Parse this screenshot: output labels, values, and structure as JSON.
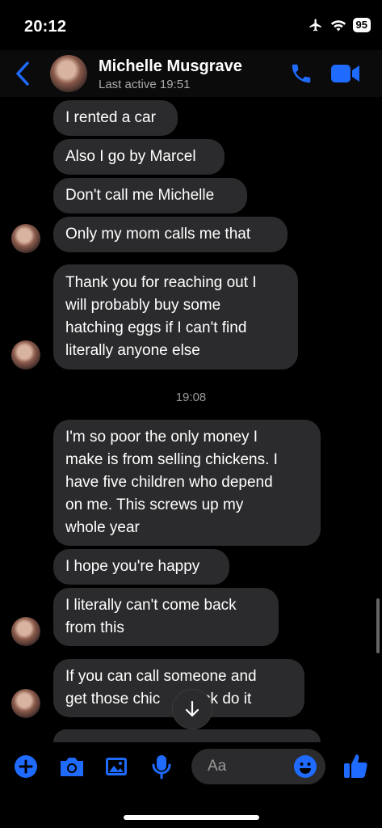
{
  "status": {
    "time": "20:12",
    "battery": "95"
  },
  "header": {
    "name": "Michelle Musgrave",
    "last_active": "Last active 19:51"
  },
  "messages": [
    {
      "text": "I rented a car"
    },
    {
      "text": "Also I go by Marcel"
    },
    {
      "text": "Don't call me Michelle"
    },
    {
      "text": "Only my mom calls me that"
    },
    {
      "lines": [
        "Thank you for reaching out I",
        "will probably buy some",
        "hatching eggs if I can't find",
        "literally anyone else"
      ]
    },
    {
      "lines": [
        "I'm so poor the only money I",
        "make is from selling chickens. I",
        "have five children who depend",
        "on me. This screws up my",
        "whole year"
      ]
    },
    {
      "text": "I hope you're happy"
    },
    {
      "lines": [
        "I literally can't come back",
        "from this"
      ]
    },
    {
      "lines": [
        "If you can call someone and",
        "get those chic      back do it"
      ]
    }
  ],
  "timestamp": "19:08",
  "composer": {
    "placeholder": "Aa"
  },
  "colors": {
    "accent": "#1f6bff",
    "bubble": "#2b2b2d"
  }
}
